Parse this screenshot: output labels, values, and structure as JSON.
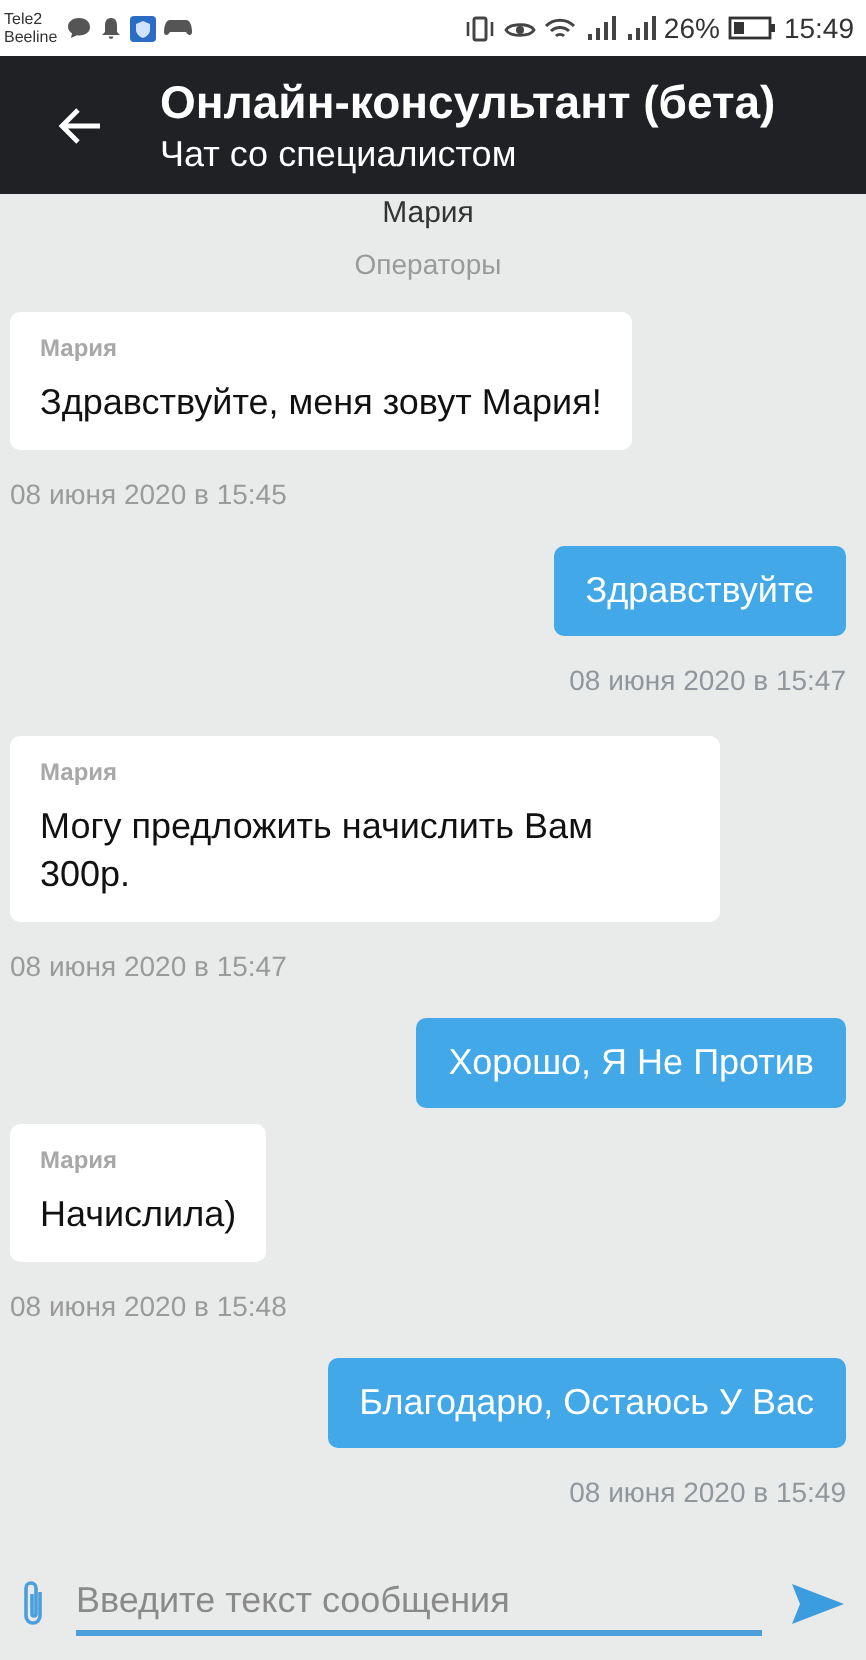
{
  "status_bar": {
    "carriers": [
      "Tele2",
      "Beeline"
    ],
    "battery": "26%",
    "time": "15:49"
  },
  "header": {
    "title": "Онлайн-консультант (бета)",
    "subtitle": "Чат со специалистом"
  },
  "operator": {
    "name": "Мария",
    "role": "Операторы"
  },
  "messages": [
    {
      "kind": "incoming",
      "sender": "Мария",
      "text": "Здравствуйте, меня зовут Мария!",
      "time": "08 июня 2020 в 15:45"
    },
    {
      "kind": "outgoing",
      "text": "Здравствуйте",
      "time": "08 июня 2020 в 15:47"
    },
    {
      "kind": "incoming",
      "sender": "Мария",
      "text": "Могу предложить начислить Вам 300р.",
      "time": "08 июня 2020 в 15:47"
    },
    {
      "kind": "outgoing",
      "text": "Хорошо, Я Не Против"
    },
    {
      "kind": "incoming",
      "sender": "Мария",
      "text": "Начислила)",
      "time": "08 июня 2020 в 15:48"
    },
    {
      "kind": "outgoing",
      "text": "Благодарю, Остаюсь У Вас",
      "time": "08 июня 2020 в 15:49"
    }
  ],
  "composer": {
    "placeholder": "Введите текст сообщения"
  }
}
